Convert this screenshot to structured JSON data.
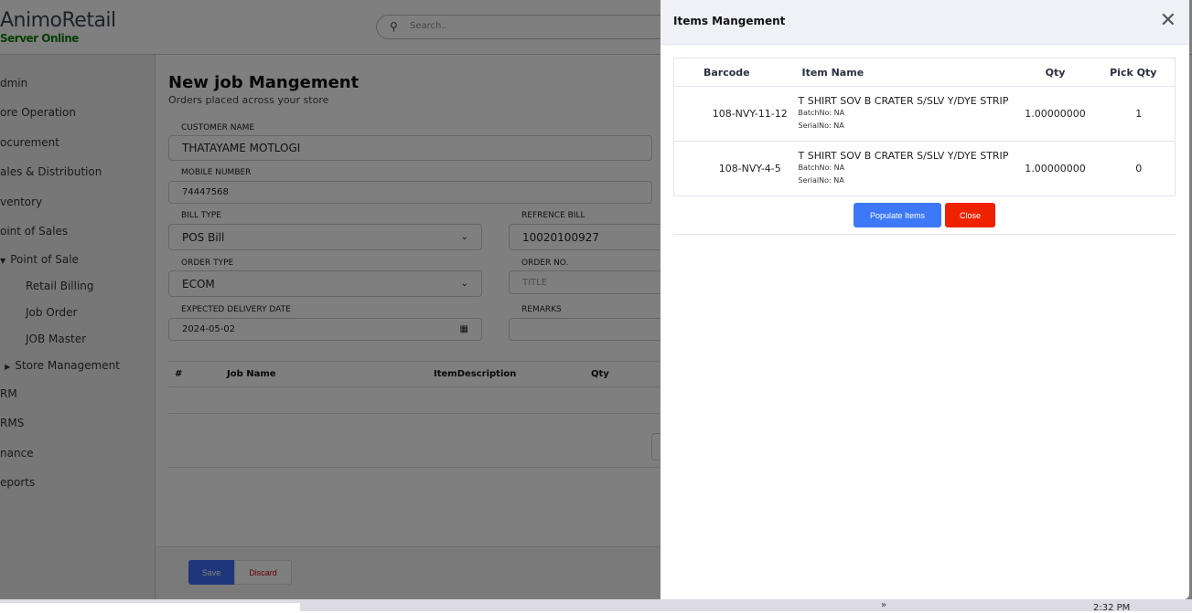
{
  "app": {
    "name": "AnimoRetail",
    "status": "Server Online",
    "search_placeholder": "Search.."
  },
  "sidebar": {
    "items": [
      "dmin",
      "ore Operation",
      "ocurement",
      "ales & Distribution",
      "ventory",
      "oint of Sales",
      "Point of Sale",
      "Retail Billing",
      "Job Order",
      "JOB Master",
      "Store Management",
      "RM",
      "RMS",
      "nance",
      "eports"
    ]
  },
  "page": {
    "title": "New job Mangement",
    "subtitle": "Orders placed across your store",
    "fields": {
      "customer_name_label": "CUSTOMER NAME",
      "customer_name": "THATAYAME MOTLOGI",
      "mobile_label": "MOBILE NUMBER",
      "mobile": "74447568",
      "bill_type_label": "BILL TYPE",
      "bill_type": "POS Bill",
      "ref_bill_label": "REFRENCE BILL",
      "ref_bill": "10020100927",
      "order_type_label": "ORDER TYPE",
      "order_type": "ECOM",
      "order_no_label": "ORDER NO.",
      "order_no_placeholder": "TITLE",
      "delivery_label": "EXPECTED DELIVERY DATE",
      "delivery": "2024-05-02",
      "remarks_label": "REMARKS"
    },
    "table_headers": [
      "#",
      "Job Name",
      "ItemDescription",
      "Qty"
    ],
    "save": "Save",
    "discard": "Discard"
  },
  "modal": {
    "title": "Items Mangement",
    "headers": [
      "Barcode",
      "Item Name",
      "Qty",
      "Pick Qty"
    ],
    "rows": [
      {
        "barcode": "108-NVY-11-12",
        "name": "T SHIRT SOV B CRATER S/SLV Y/DYE STRIP",
        "batch": "BatchNo: NA",
        "serial": "SerialNo: NA",
        "qty": "1.00000000",
        "pick": "1"
      },
      {
        "barcode": "108-NVY-4-5",
        "name": "T SHIRT SOV B CRATER S/SLV Y/DYE STRIP",
        "batch": "BatchNo: NA",
        "serial": "SerialNo: NA",
        "qty": "1.00000000",
        "pick": "0"
      }
    ],
    "populate": "Populate Items",
    "close": "Close"
  },
  "taskbar": {
    "time": "2:32 PM"
  }
}
